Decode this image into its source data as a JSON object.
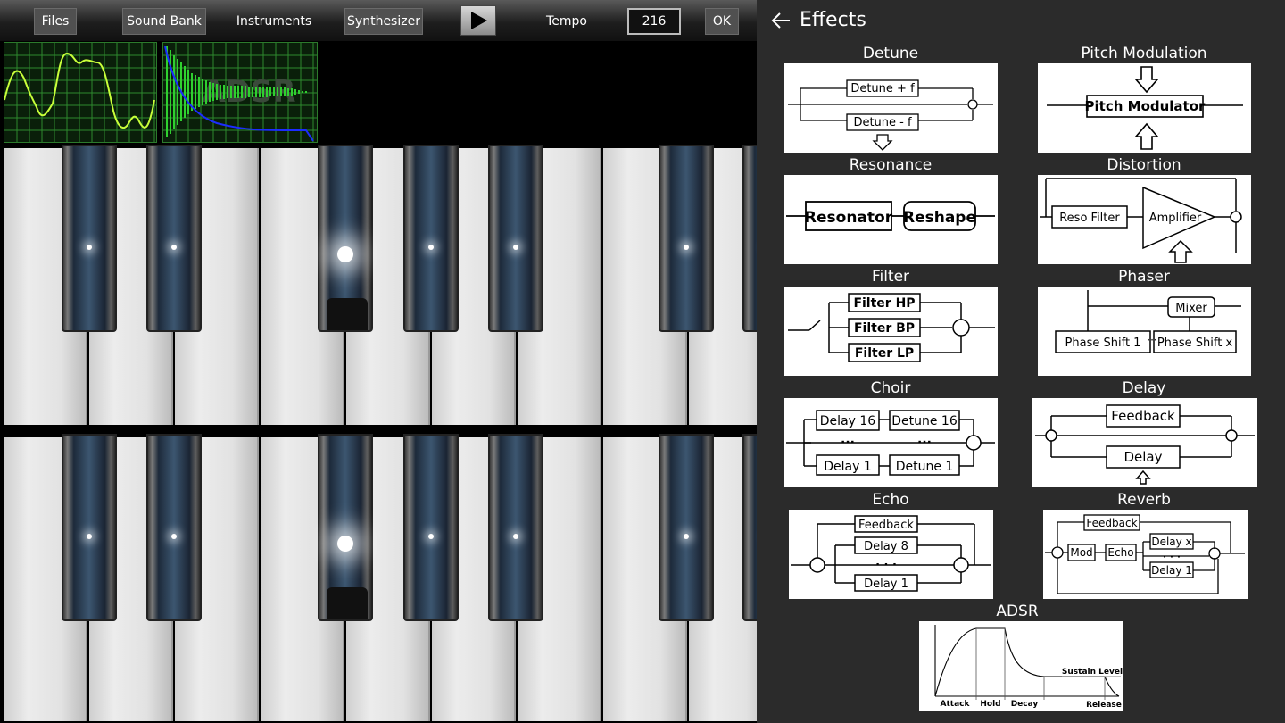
{
  "toolbar": {
    "files": "Files",
    "sound_bank": "Sound Bank",
    "instruments": "Instruments",
    "synthesizer": "Synthesizer",
    "tempo_label": "Tempo",
    "tempo_value": "216",
    "ok": "OK",
    "play_icon": "play-icon"
  },
  "scope": {
    "envelope_watermark": "ADSR"
  },
  "panel": {
    "title": "Effects",
    "back_icon": "arrow-left-icon"
  },
  "effects": {
    "detune": {
      "label": "Detune",
      "top": "Detune + f",
      "bottom": "Detune - f"
    },
    "pitch": {
      "label": "Pitch Modulation",
      "block": "Pitch Modulator"
    },
    "resonance": {
      "label": "Resonance",
      "block1": "Resonator",
      "block2": "Reshape"
    },
    "distortion": {
      "label": "Distortion",
      "block1": "Reso Filter",
      "block2": "Amplifier"
    },
    "filter": {
      "label": "Filter",
      "hp": "Filter HP",
      "bp": "Filter BP",
      "lp": "Filter LP"
    },
    "phaser": {
      "label": "Phaser",
      "mixer": "Mixer",
      "shift1": "Phase Shift 1",
      "shiftx": "Phase Shift x",
      "dots": "···"
    },
    "choir": {
      "label": "Choir",
      "delay16": "Delay 16",
      "detune16": "Detune 16",
      "delay1": "Delay 1",
      "detune1": "Detune 1",
      "dots": "···"
    },
    "delay": {
      "label": "Delay",
      "feedback": "Feedback",
      "delay": "Delay"
    },
    "echo": {
      "label": "Echo",
      "feedback": "Feedback",
      "delay8": "Delay 8",
      "delay1": "Delay 1",
      "dots": "· · ·"
    },
    "reverb": {
      "label": "Reverb",
      "feedback": "Feedback",
      "mod": "Mod",
      "echo": "Echo",
      "delayx": "Delay x",
      "delay1": "Delay 1",
      "dots": "· · ·"
    },
    "adsr": {
      "label": "ADSR",
      "sustain": "Sustain Level",
      "attack": "Attack",
      "hold": "Hold",
      "decay": "Decay",
      "release": "Release"
    }
  }
}
